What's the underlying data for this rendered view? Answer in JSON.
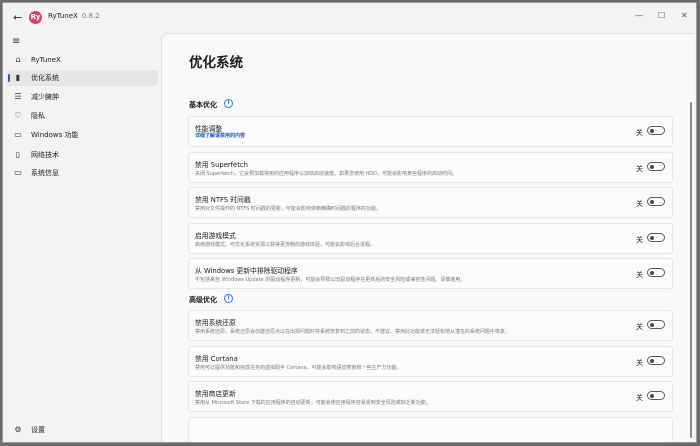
{
  "app": {
    "title": "RyTuneX",
    "version": "0.8.2",
    "logo_text": "Ry"
  },
  "titlebar": {
    "back": "←",
    "minimize": "—",
    "maximize": "☐",
    "close": "✕"
  },
  "sidebar": {
    "menu_icon": "≡",
    "items": [
      {
        "label": "RyTuneX",
        "icon": "home-icon",
        "glyph": "⌂"
      },
      {
        "label": "优化系统",
        "icon": "optimize-icon",
        "glyph": "▮",
        "active": true
      },
      {
        "label": "减少臃肿",
        "icon": "list-icon",
        "glyph": "☰"
      },
      {
        "label": "隐私",
        "icon": "shield-icon",
        "glyph": "♡"
      },
      {
        "label": "Windows 功能",
        "icon": "windows-features-icon",
        "glyph": "▭"
      },
      {
        "label": "网络技术",
        "icon": "network-icon",
        "glyph": "▯"
      },
      {
        "label": "系统信息",
        "icon": "laptop-icon",
        "glyph": "▭"
      }
    ],
    "settings": {
      "label": "设置",
      "icon": "gear-icon",
      "glyph": "⚙"
    }
  },
  "main": {
    "title": "优化系统",
    "sections": [
      {
        "title": "基本优化",
        "info_glyph": "i"
      },
      {
        "title": "高级优化",
        "info_glyph": "i"
      }
    ],
    "cards": [
      {
        "title": "性能调整",
        "desc": "详细了解请禁用的内容",
        "desc_is_link": true,
        "toggle_label": "关",
        "on": false
      },
      {
        "title": "禁用 Superfetch",
        "desc": "关闭 Superfetch，它会预加载常用的应用程序以加快启动速度。如果您使用 HDD，可能会影响某些程序的启动时间。",
        "toggle_label": "关",
        "on": false
      },
      {
        "title": "禁用 NTFS 时间戳",
        "desc": "禁用对文件操作的 NTFS 时间戳的更新，可能会影响依赖精确时间戳的程序的功能。",
        "toggle_label": "关",
        "on": false
      },
      {
        "title": "启用游戏模式",
        "desc": "启用游戏模式，可优化系统资源以获得更流畅的游戏体验，可能会影响后台进程。",
        "toggle_label": "关",
        "on": false
      },
      {
        "title": "从 Windows 更新中排除驱动程序",
        "desc": "不包括来自 Windows Update 的驱动程序更新，可能会导致以旧驱动程序在更新后的安全风险或兼容性问题。请慎使用。",
        "toggle_label": "关",
        "on": false
      },
      {
        "title": "禁用系统还原",
        "desc": "禁用系统还原，系统还原会创建还原点以在出现问题时将系统恢复到之前的状态。不建议。禁用此功能将无法轻松地从潜在的系统问题中恢复。",
        "toggle_label": "关",
        "on": false
      },
      {
        "title": "禁用 Cortana",
        "desc": "禁用可以提供功能和完成任务的虚拟助手 Cortana，可能会影响语音搜索和一些生产力功能。",
        "toggle_label": "关",
        "on": false
      },
      {
        "title": "禁用商店更新",
        "desc": "禁用从 Microsoft Store 下载的应用程序的自动更新，可能会使应用程序容易受到安全风险或缺乏新功能。",
        "toggle_label": "关",
        "on": false
      }
    ]
  }
}
